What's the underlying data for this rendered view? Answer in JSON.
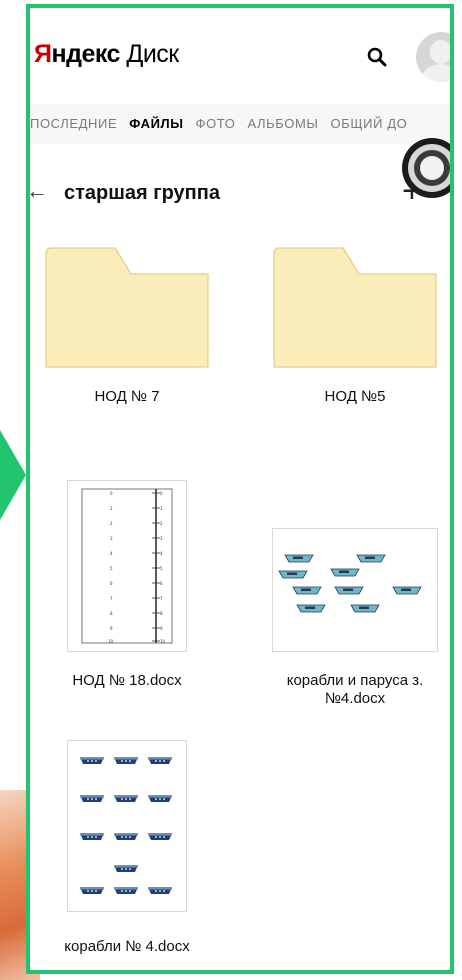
{
  "app": {
    "logo": {
      "brand_first": "Я",
      "brand_rest": "ндекс",
      "product": " Диск"
    }
  },
  "tabs": [
    "ПОСЛЕДНИЕ",
    "ФАЙЛЫ",
    "ФОТО",
    "АЛЬБОМЫ",
    "ОБЩИЙ ДО"
  ],
  "active_tab": "ФАЙЛЫ",
  "folder": {
    "title": "старшая группа"
  },
  "items": [
    {
      "name": "НОД № 7",
      "type": "folder"
    },
    {
      "name": "НОД №5",
      "type": "folder"
    },
    {
      "name": "НОД № 18.docx",
      "type": "docx"
    },
    {
      "name": "корабли и паруса з.№4.docx",
      "type": "docx"
    },
    {
      "name": "корабли № 4.docx",
      "type": "docx"
    }
  ],
  "colors": {
    "frame": "#22c46e",
    "brand_red": "#cc0000",
    "folder_fill": "#faedb9",
    "folder_stroke": "#e2cf86",
    "boat_light": "#6fb7c9",
    "boat_dark": "#1d3f7a"
  },
  "icons": [
    "search-icon",
    "user-avatar-icon",
    "back-arrow-icon",
    "plus-icon",
    "camera-icon"
  ]
}
